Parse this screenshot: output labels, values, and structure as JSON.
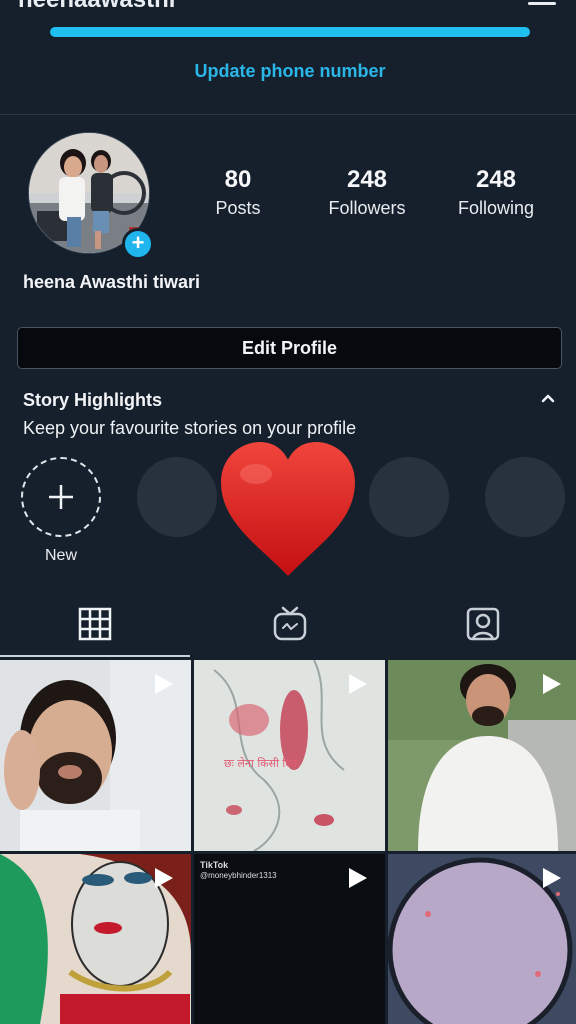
{
  "header": {
    "username": "heenaawasthi",
    "menu_icon": "hamburger-menu-icon",
    "profile_completion": 1.0,
    "update_link": "Update phone number"
  },
  "profile": {
    "avatar_icon": "profile-photo",
    "add_story_icon": "plus-icon",
    "full_name": "heena Awasthi tiwari",
    "stats": [
      {
        "value": "80",
        "label": "Posts"
      },
      {
        "value": "248",
        "label": "Followers"
      },
      {
        "value": "248",
        "label": "Following"
      }
    ],
    "edit_button": "Edit Profile"
  },
  "highlights": {
    "title": "Story Highlights",
    "subtitle": "Keep your favourite stories on your profile",
    "collapse_icon": "chevron-up-icon",
    "new_label": "New",
    "new_icon": "plus-icon"
  },
  "overlay": {
    "sticker": "heart-sticker",
    "color": "#e0201c"
  },
  "tabs": [
    {
      "icon": "grid-icon",
      "active": true
    },
    {
      "icon": "igtv-icon",
      "active": false
    },
    {
      "icon": "tagged-person-icon",
      "active": false
    }
  ],
  "posts": [
    {
      "media": "video",
      "icon": "play-icon"
    },
    {
      "media": "video",
      "icon": "play-icon",
      "caption": "छः लेना किसी दिन"
    },
    {
      "media": "video",
      "icon": "play-icon"
    },
    {
      "media": "video",
      "icon": "play-icon"
    },
    {
      "media": "video",
      "icon": "play-icon",
      "watermark_brand": "TikTok",
      "watermark_handle": "@moneybhinder1313"
    },
    {
      "media": "video",
      "icon": "play-icon"
    }
  ],
  "colors": {
    "background": "#16202c",
    "accent": "#1fbff0",
    "button_bg": "#06090e"
  }
}
